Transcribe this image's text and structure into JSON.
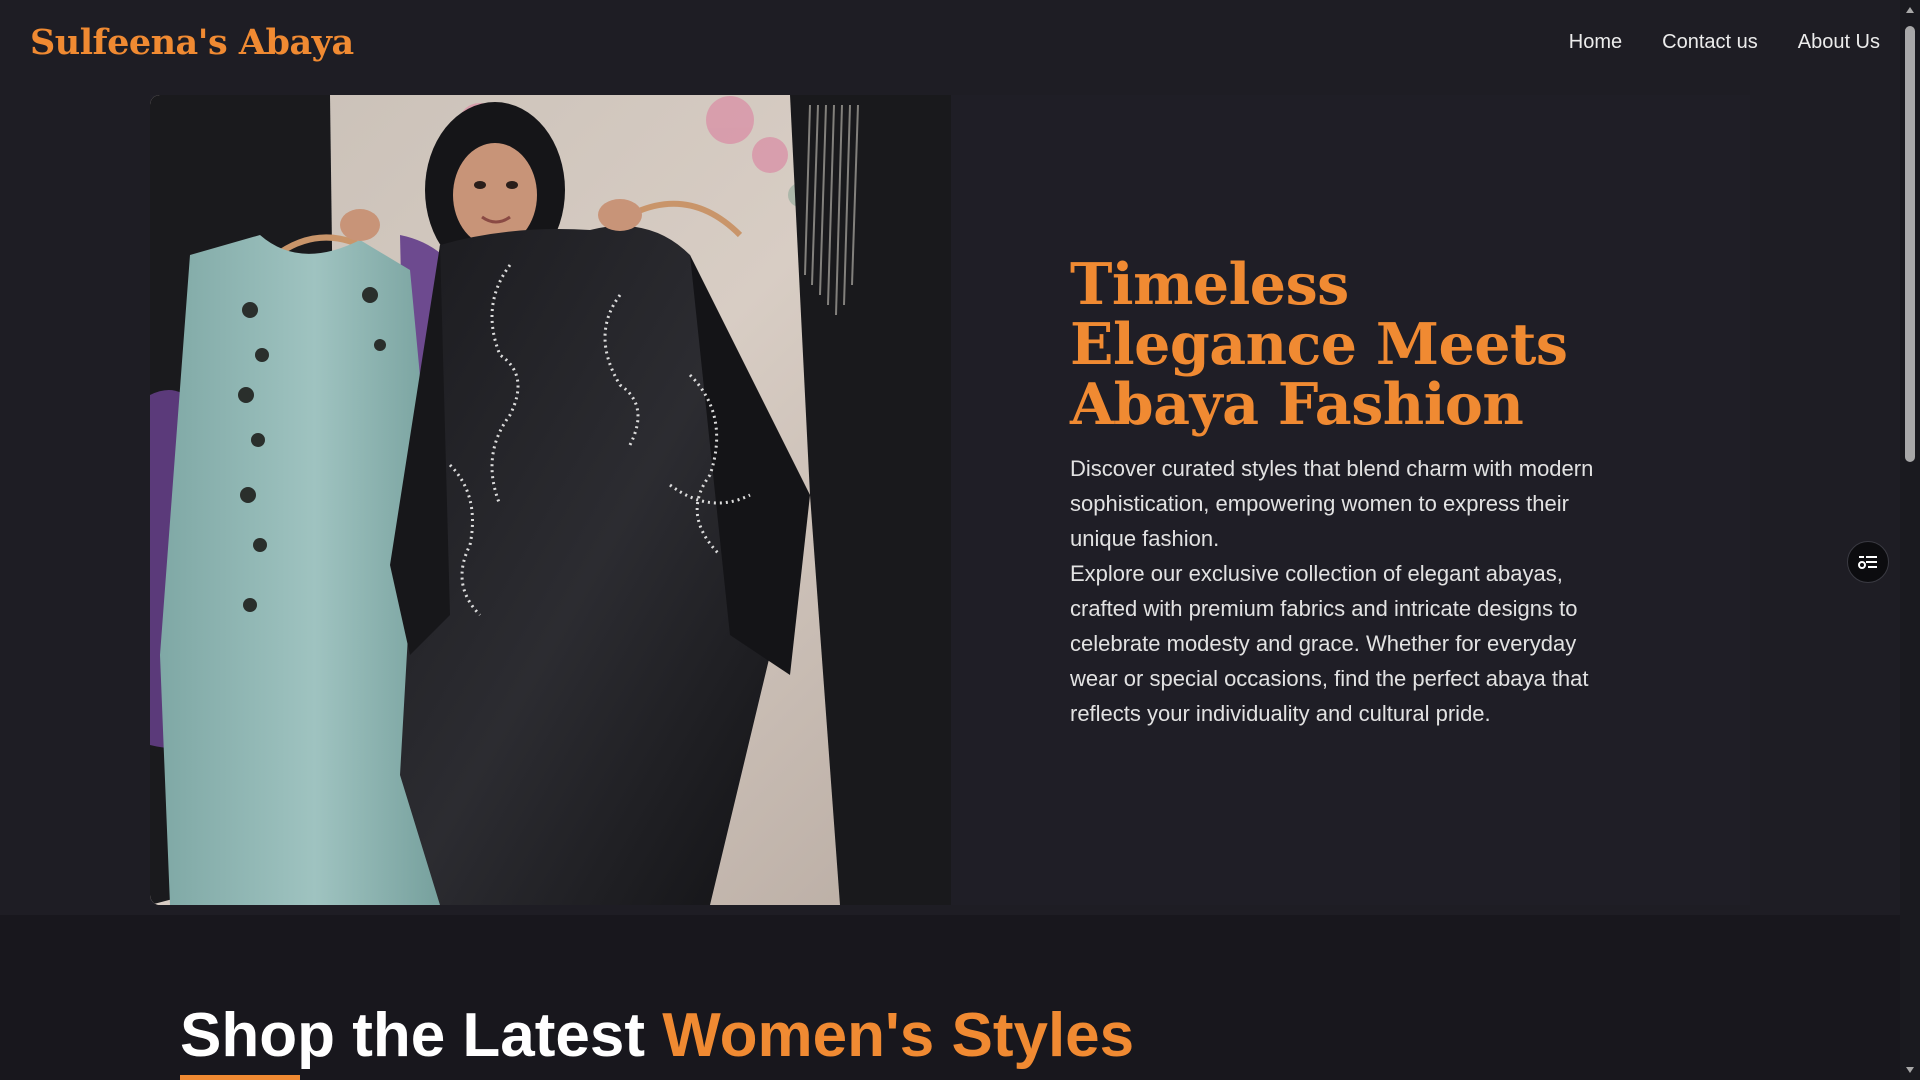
{
  "brand": {
    "name": "Sulfeena's Abaya"
  },
  "nav": {
    "items": [
      "Home",
      "Contact us",
      "About Us"
    ]
  },
  "hero": {
    "title_line1": "Timeless",
    "title_line2": "Elegance Meets",
    "title_line3": "Abaya Fashion",
    "description_1": "Discover curated styles that blend charm with modern sophistication, empowering women to express their unique fashion.",
    "description_2": "Explore our exclusive collection of elegant abayas, crafted with premium fabrics and intricate designs to celebrate modesty and grace. Whether for everyday wear or special occasions, find the perfect abaya that reflects your individuality and cultural pride."
  },
  "shop": {
    "title_main": "Shop the Latest ",
    "title_accent": "Women's Styles"
  },
  "colors": {
    "accent": "#f08a32",
    "background": "#1e1d24",
    "section_background": "#18171d"
  },
  "icons": {
    "floating_button": "filter-list-icon",
    "scroll_up": "scroll-up-arrow-icon",
    "scroll_down": "scroll-down-arrow-icon"
  }
}
